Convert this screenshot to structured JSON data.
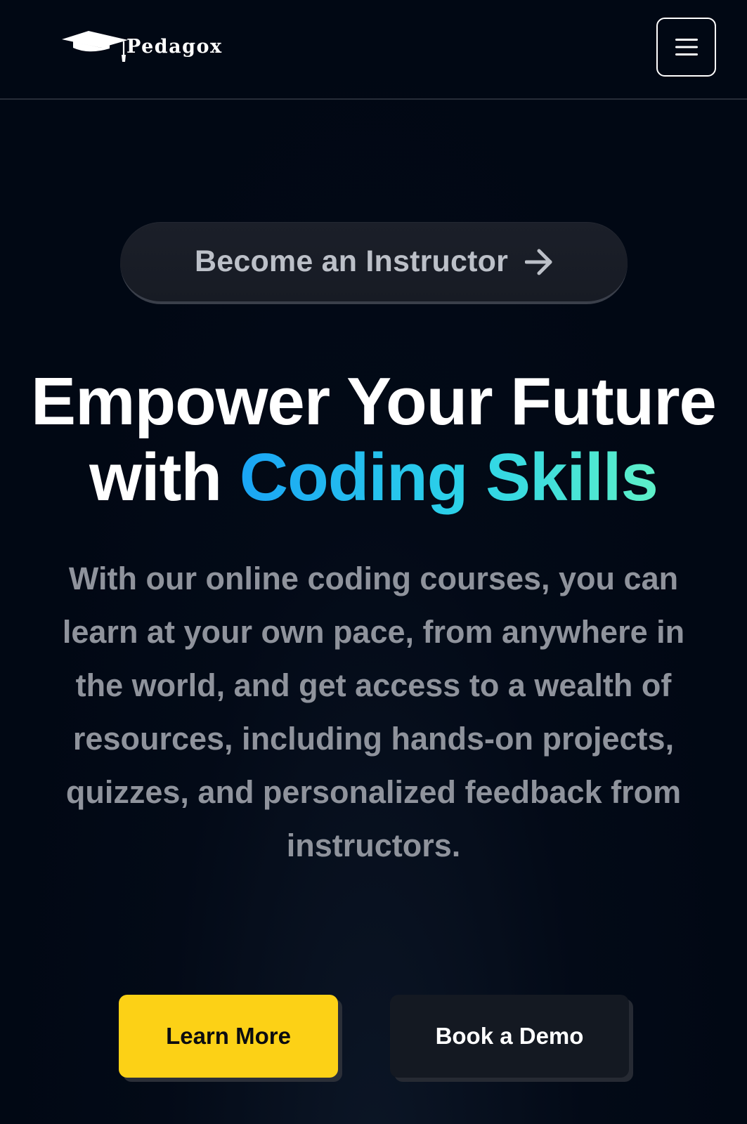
{
  "header": {
    "brand_name": "Pedagox",
    "logo_icon": "graduation-cap-icon",
    "menu_icon": "hamburger-menu-icon"
  },
  "hero": {
    "badge_label": "Become an Instructor",
    "badge_icon": "arrow-right-icon",
    "headline_line1": "Empower Your Future",
    "headline_line2_prefix": "with",
    "headline_line2_accent": "Coding Skills",
    "description": "With our online coding courses, you can learn at your own pace, from anywhere in the world, and get access to a wealth of resources, including hands-on projects, quizzes, and personalized feedback from instructors.",
    "primary_button": "Learn More",
    "secondary_button": "Book a Demo"
  },
  "colors": {
    "background": "#010814",
    "primary_button": "#fcd116",
    "secondary_button": "#141922",
    "accent_gradient_start": "#1aa5f5",
    "accent_gradient_end": "#5ef0c8",
    "muted_text": "#8f939c"
  }
}
